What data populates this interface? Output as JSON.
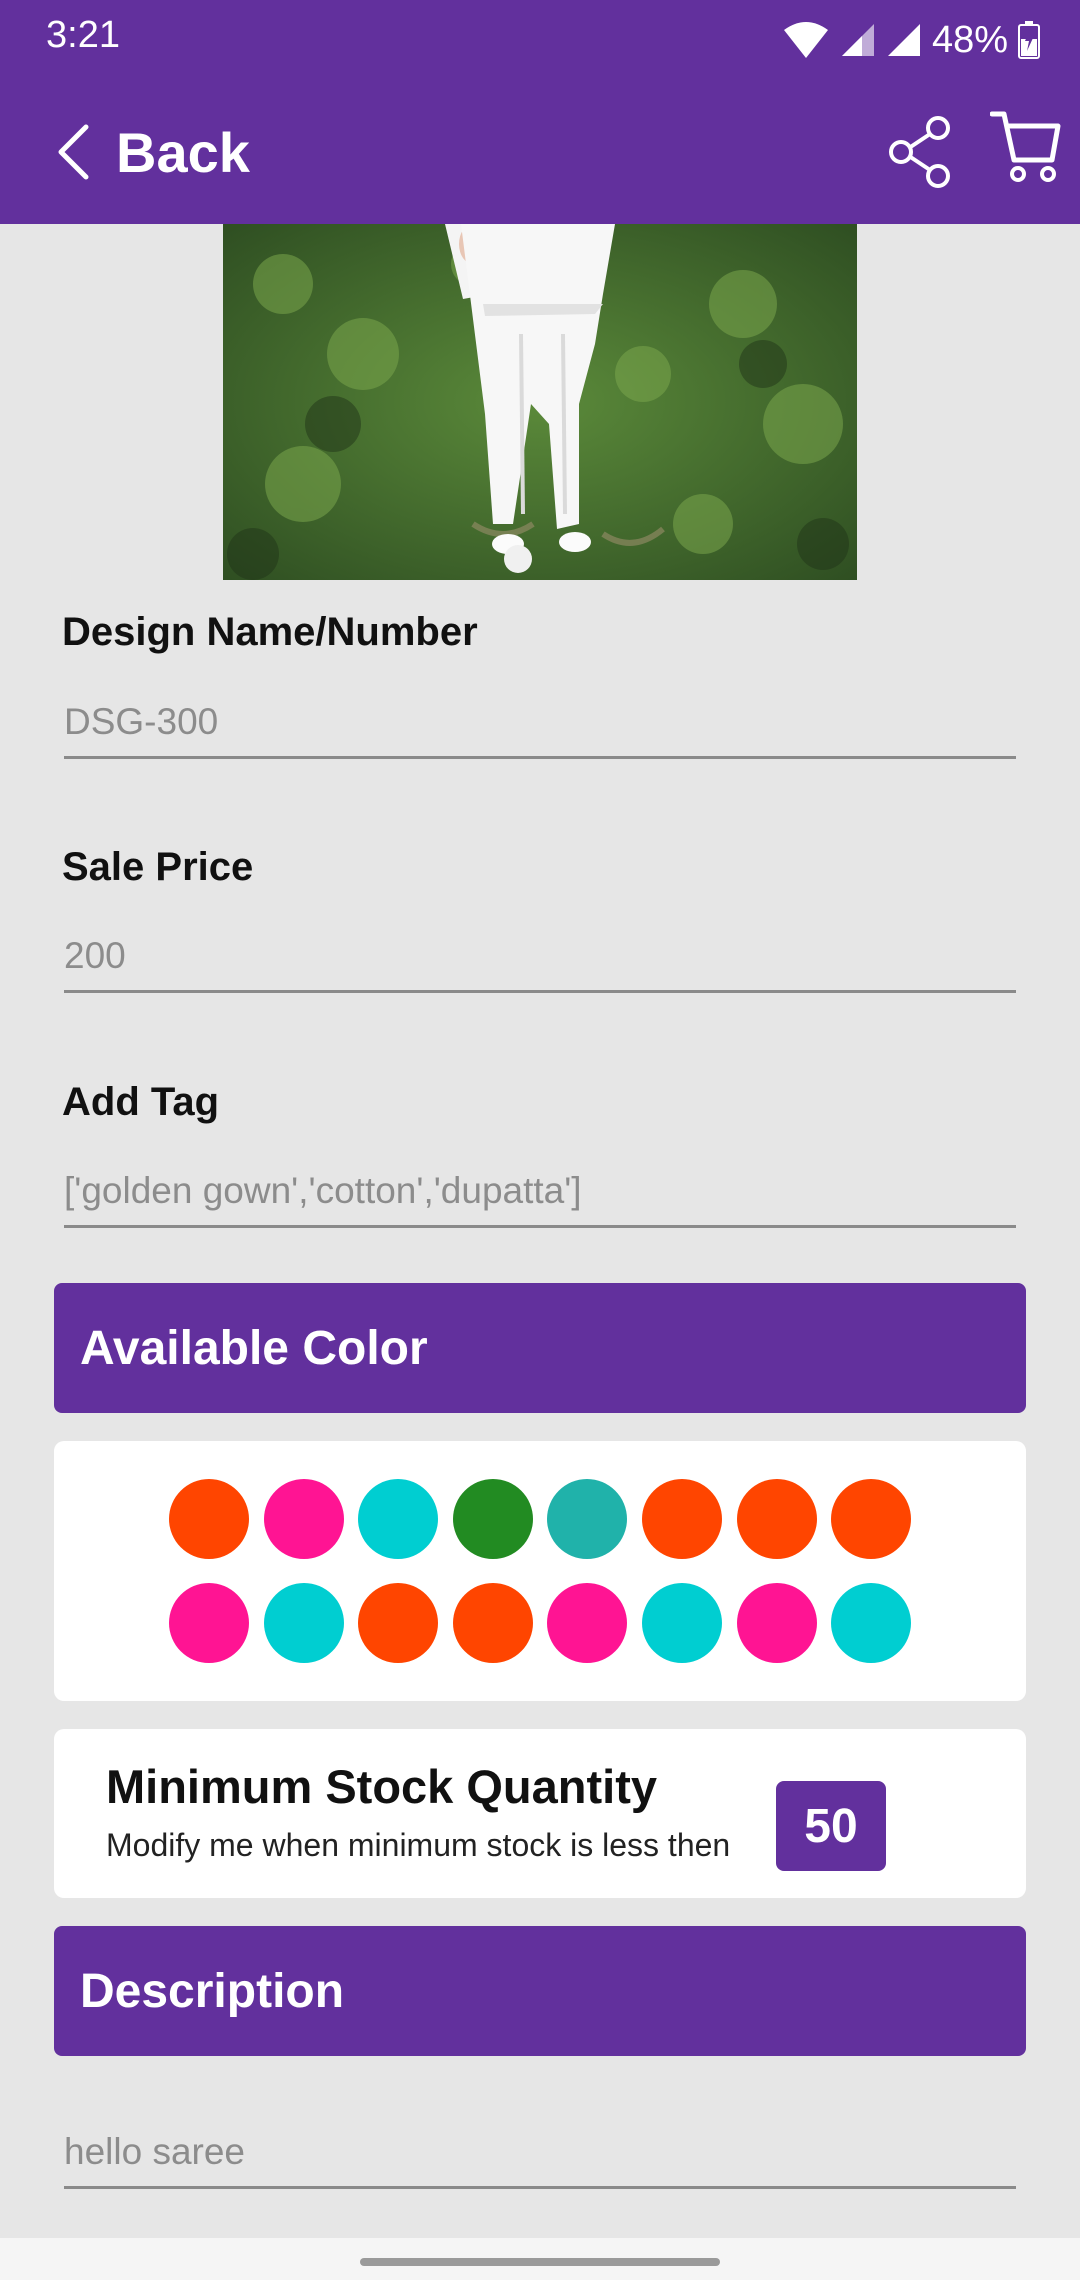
{
  "status_bar": {
    "time": "3:21",
    "battery": "48%"
  },
  "app_bar": {
    "back_label": "Back",
    "share_icon": "share-icon",
    "cart_icon": "cart-icon"
  },
  "form": {
    "design": {
      "label": "Design Name/Number",
      "placeholder": "DSG-300"
    },
    "price": {
      "label": "Sale Price",
      "placeholder": "200"
    },
    "tag": {
      "label": "Add Tag",
      "placeholder": "['golden gown','cotton','dupatta']"
    }
  },
  "available_color": {
    "title": "Available Color",
    "swatches": [
      "#ff4500",
      "#ff1493",
      "#00ced1",
      "#228b22",
      "#20b2aa",
      "#ff4500",
      "#ff4500",
      "#ff4500",
      "#ff1493",
      "#00ced1",
      "#ff4500",
      "#ff4500",
      "#ff1493",
      "#00ced1",
      "#ff1493",
      "#00ced1"
    ]
  },
  "stock": {
    "title": "Minimum Stock Quantity",
    "subtitle": "Modify me when minimum stock is less then",
    "value": "50"
  },
  "description": {
    "title": "Description",
    "placeholder": "hello saree"
  },
  "colors": {
    "primary": "#62309d",
    "background": "#e6e6e6"
  }
}
